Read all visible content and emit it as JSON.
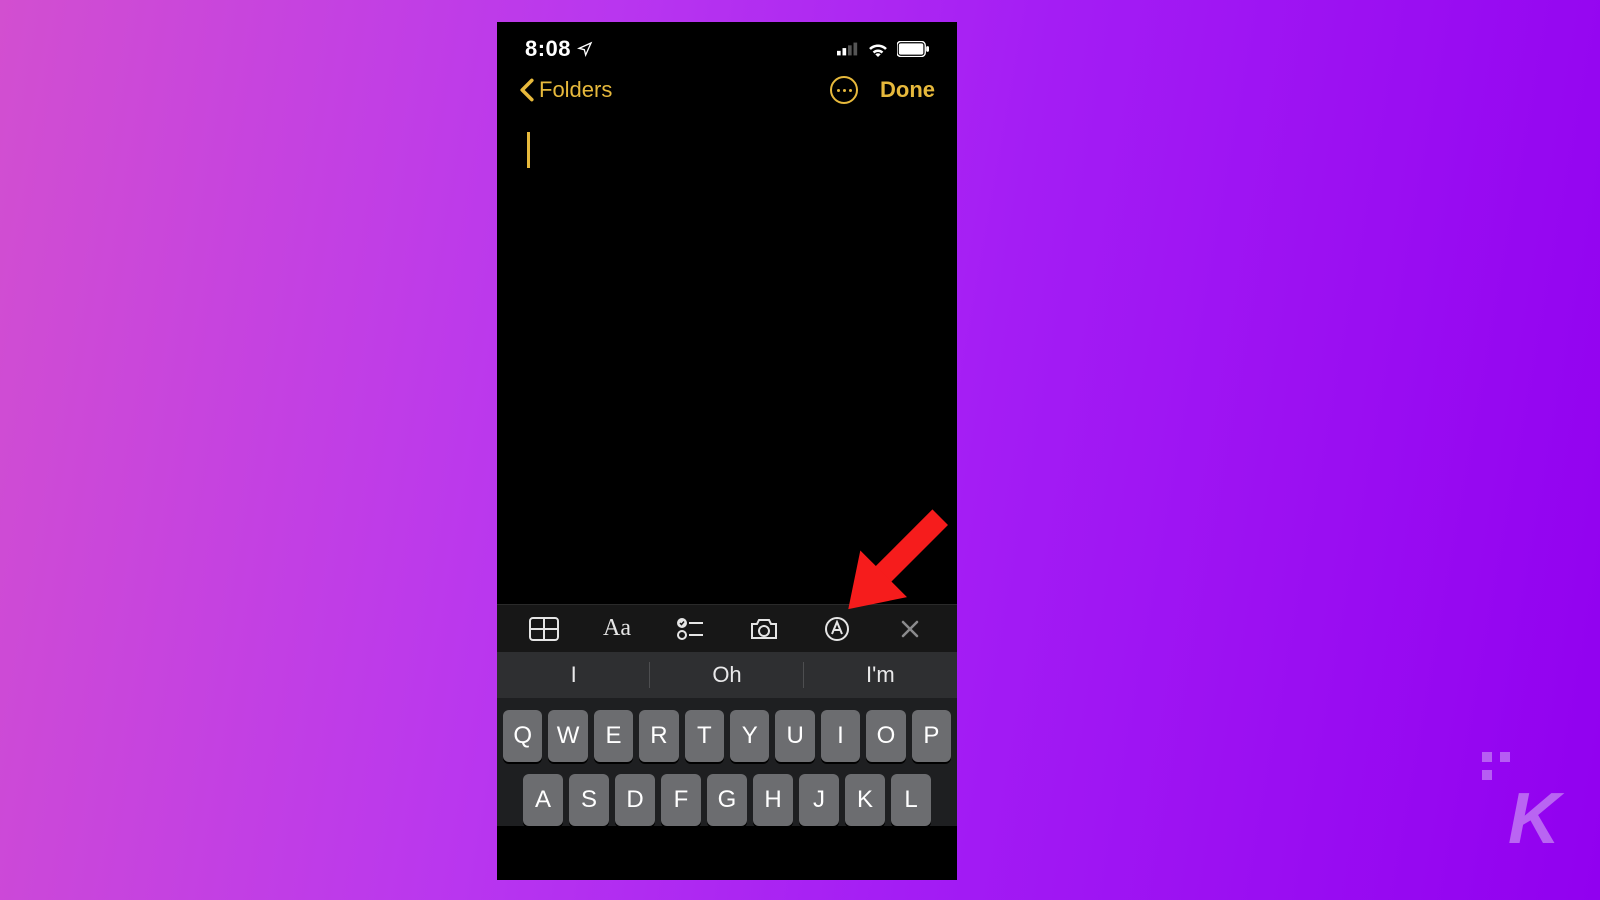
{
  "status": {
    "time": "8:08"
  },
  "nav": {
    "back_label": "Folders",
    "done_label": "Done"
  },
  "toolbar": {
    "aa": "Aa"
  },
  "suggestions": [
    "I",
    "Oh",
    "I'm"
  ],
  "keyboard": {
    "row1": [
      "Q",
      "W",
      "E",
      "R",
      "T",
      "Y",
      "U",
      "I",
      "O",
      "P"
    ],
    "row2": [
      "A",
      "S",
      "D",
      "F",
      "G",
      "H",
      "J",
      "K",
      "L"
    ]
  },
  "watermark": "K",
  "colors": {
    "accent": "#e7b93c",
    "arrow": "#f61c1c"
  }
}
